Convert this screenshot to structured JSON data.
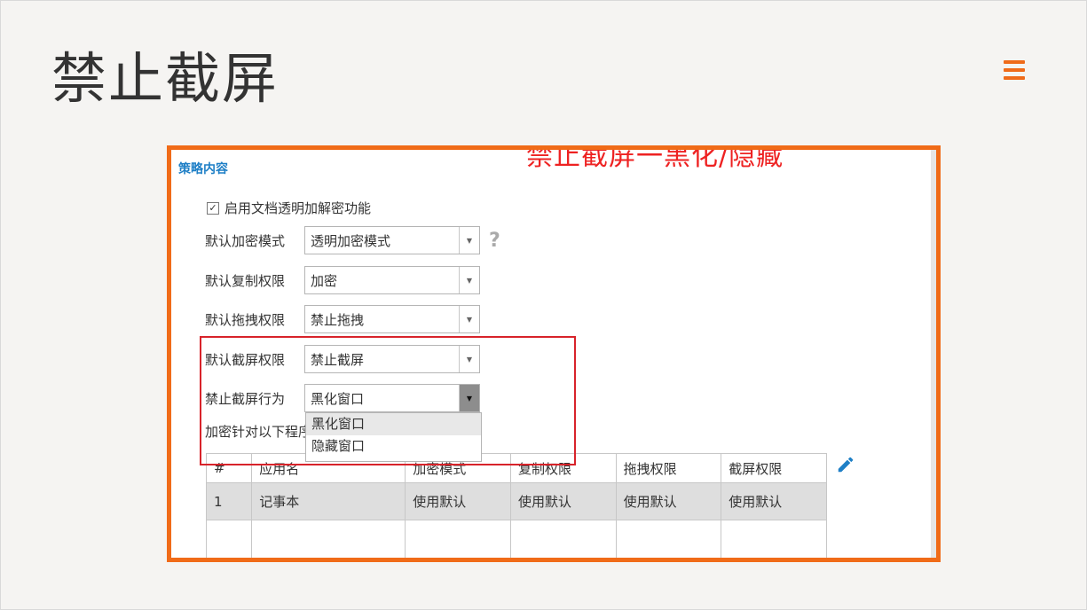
{
  "page": {
    "title": "禁止截屏"
  },
  "screenshot": {
    "overlay_text": "禁止截屏一黑化/隐藏",
    "section_title": "策略内容",
    "enable_checkbox": {
      "label": "启用文档透明加解密功能",
      "checked": true,
      "mark": "✓"
    },
    "fields": [
      {
        "label": "默认加密模式",
        "value": "透明加密模式",
        "has_help": true
      },
      {
        "label": "默认复制权限",
        "value": "加密"
      },
      {
        "label": "默认拖拽权限",
        "value": "禁止拖拽"
      },
      {
        "label": "默认截屏权限",
        "value": "禁止截屏"
      },
      {
        "label": "禁止截屏行为",
        "value": "黑化窗口",
        "open": true
      }
    ],
    "help_glyph": "?",
    "dropdown_arrow": "▼",
    "dropdown_options": [
      "黑化窗口",
      "隐藏窗口"
    ],
    "encrypt_label": "加密针对以下程序",
    "table": {
      "headers": [
        "#",
        "应用名",
        "加密模式",
        "复制权限",
        "拖拽权限",
        "截屏权限"
      ],
      "rows": [
        [
          "1",
          "记事本",
          "使用默认",
          "使用默认",
          "使用默认",
          "使用默认"
        ]
      ]
    },
    "colors": {
      "frame": "#f06b18",
      "highlight_box": "#d8232a",
      "overlay_text": "#e22222",
      "section_title": "#1e7fc6"
    },
    "icons": {
      "menu": "hamburger-menu-icon",
      "edit": "pencil-edit-icon",
      "help": "question-mark-icon"
    }
  }
}
